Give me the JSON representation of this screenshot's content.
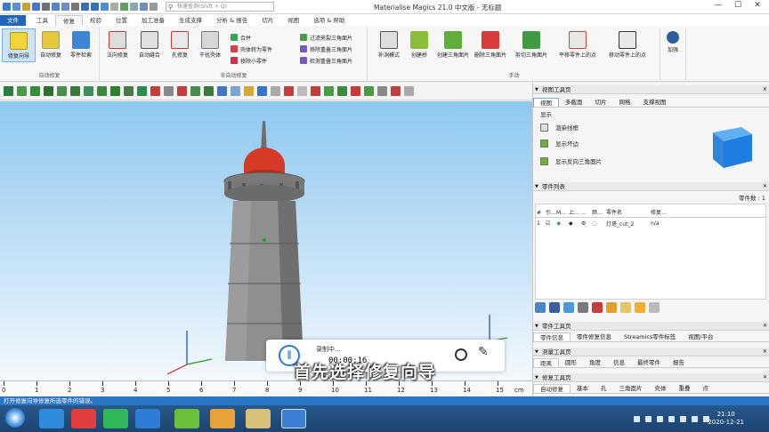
{
  "window": {
    "title": "Materialise Magics 21.0 中文版 - 无标题",
    "search_placeholder": "快速查询(Shift + Q)",
    "controls": [
      "—",
      "☐",
      "✕"
    ]
  },
  "ribbon_tabs": [
    "文件",
    "工具",
    "修复",
    "校验",
    "位置",
    "加工准备",
    "生成支撑",
    "分析 & 报告",
    "切片",
    "视图",
    "选项 & 帮助"
  ],
  "ribbon": {
    "groups": [
      {
        "label": "自动修复",
        "buttons": [
          "修复向导",
          "自动修复",
          "零件检索"
        ]
      },
      {
        "label": "半自动修复",
        "buttons": [
          "法向修复",
          "自动缝合",
          "孔修复",
          "干扰壳体"
        ],
        "small_buttons": [
          "合并",
          "壳体转为零件",
          "移除小零件",
          "过滤夹裂三角面片",
          "移除重叠三角面片",
          "检测重叠三角面片"
        ]
      },
      {
        "label": "手动",
        "buttons": [
          "补洞模式",
          "创建桥",
          "创建三角面片",
          "删除三角面片",
          "剪切三角面片",
          "平移零件上的点",
          "移动零件上的点"
        ]
      },
      {
        "label": "",
        "buttons": [
          "加强"
        ]
      }
    ]
  },
  "viewport": {
    "ruler_unit": "cm",
    "ruler_numbers": [
      "0",
      "1",
      "2",
      "3",
      "4",
      "5",
      "6",
      "7",
      "8",
      "9",
      "10",
      "11",
      "12",
      "13",
      "14",
      "15"
    ],
    "recorder": {
      "status": "录制中...",
      "time": "00:00:16"
    },
    "subtitle": "首先选择修复向导"
  },
  "right_panel": {
    "view_toolbox": {
      "title": "视图工具页",
      "tabs": [
        "视图",
        "多截面",
        "切片",
        "网格",
        "支撑视图"
      ],
      "section": "显示",
      "options": [
        "渲染线框",
        "显示坏边",
        "显示反向三角面片"
      ]
    },
    "parts_list": {
      "title": "零件列表",
      "count_label": "零件数 : 1",
      "columns": [
        "#",
        "引…",
        "M…",
        "上…",
        "…",
        "颜…",
        "零件名",
        "修复…"
      ],
      "rows": [
        {
          "num": "1",
          "name": "灯塔_cut_2",
          "repair": "n/a"
        }
      ]
    },
    "part_toolbox": {
      "title": "零件工具页",
      "tabs": [
        "零件信息",
        "零件修复信息",
        "Streamics零件标签",
        "视图/平台"
      ]
    },
    "measure_toolbox": {
      "title": "测量工具页",
      "tabs": [
        "距离",
        "圆形",
        "角度",
        "信息",
        "最终零件",
        "报告"
      ]
    },
    "repair_toolbox": {
      "title": "修复工具页",
      "tabs": [
        "自动修复",
        "基本",
        "孔",
        "三角面片",
        "壳体",
        "重叠",
        "点"
      ]
    }
  },
  "statusbar": {
    "message": "打开修复向导修复所选零件的错误。"
  },
  "taskbar": {
    "clock_time": "21:10",
    "clock_date": "2020-12-21"
  }
}
